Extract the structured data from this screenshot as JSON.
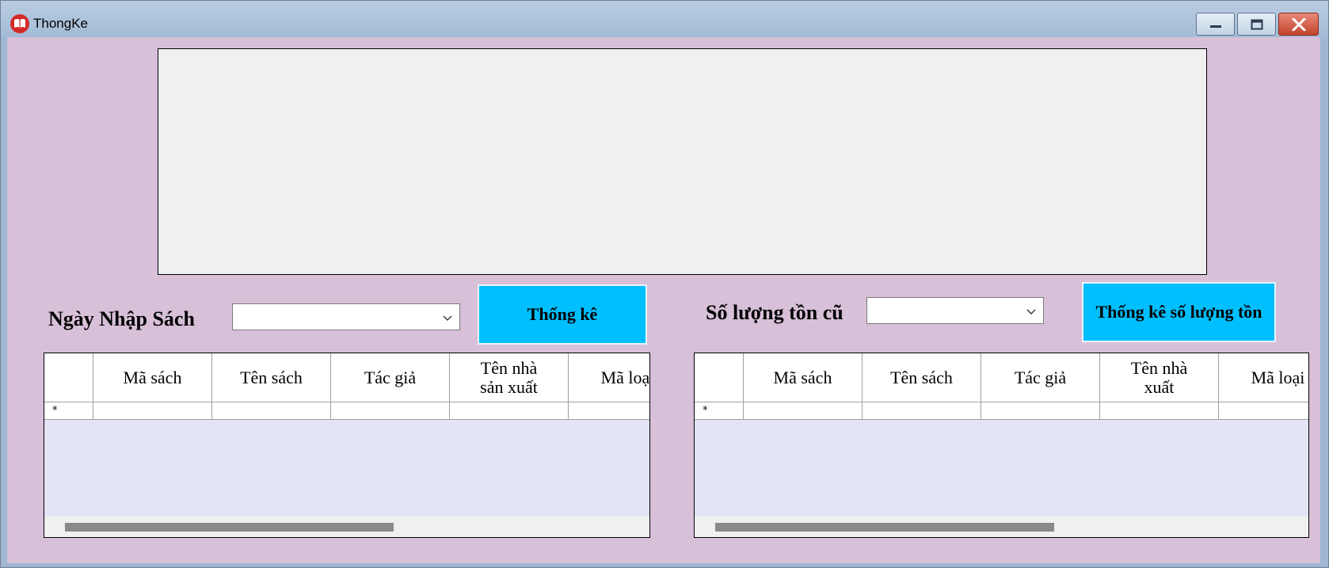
{
  "window": {
    "title": "ThongKe",
    "icon": "book-icon",
    "controls": {
      "minimize": "minimize-icon",
      "maximize": "maximize-icon",
      "close": "close-icon"
    }
  },
  "chart_area": {
    "content": ""
  },
  "left_panel": {
    "label": "Ngày Nhập Sách",
    "combo_value": "",
    "button_label": "Thống kê",
    "grid": {
      "columns": [
        "Mã sách",
        "Tên sách",
        "Tác giả",
        "Tên nhà\nsản xuất",
        "Mã loại"
      ],
      "new_row_marker": "*"
    }
  },
  "right_panel": {
    "label": "Số lượng tồn cũ",
    "combo_value": "",
    "button_label": "Thống kê số lượng tồn",
    "grid": {
      "columns": [
        "Mã sách",
        "Tên sách",
        "Tác giả",
        "Tên nhà\nxuất",
        "Mã loại"
      ],
      "new_row_marker": "*"
    }
  },
  "colors": {
    "client_background": "#d8c0d8",
    "button_background": "#00bfff",
    "grid_background": "#e4e4f7",
    "chart_background": "#f0f0f0"
  }
}
